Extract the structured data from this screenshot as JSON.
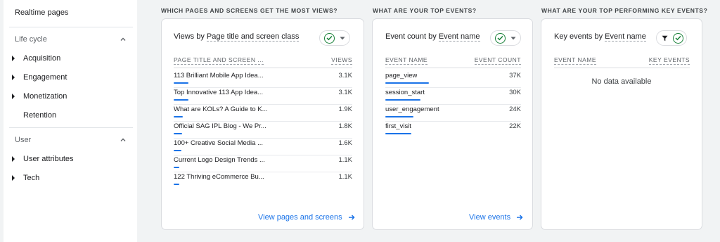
{
  "sidebar": {
    "realtime": "Realtime pages",
    "lifecycle": {
      "label": "Life cycle",
      "items": [
        "Acquisition",
        "Engagement",
        "Monetization",
        "Retention"
      ]
    },
    "user": {
      "label": "User",
      "items": [
        "User attributes",
        "Tech"
      ]
    }
  },
  "pages": {
    "section_title": "WHICH PAGES AND SCREENS GET THE MOST VIEWS?",
    "card_title_a": "Views by",
    "card_title_b": "Page title and screen class",
    "col_name": "PAGE TITLE AND SCREEN ...",
    "col_value": "VIEWS",
    "rows": [
      {
        "label": "113 Brilliant Mobile App Idea...",
        "value": "3.1K",
        "bar": 1.0
      },
      {
        "label": "Top Innovative 113 App Idea...",
        "value": "3.1K",
        "bar": 1.0
      },
      {
        "label": "What are KOLs? A Guide to K...",
        "value": "1.9K",
        "bar": 0.61
      },
      {
        "label": "Official SAG IPL Blog - We Pr...",
        "value": "1.8K",
        "bar": 0.58
      },
      {
        "label": "100+ Creative Social Media ...",
        "value": "1.6K",
        "bar": 0.52
      },
      {
        "label": "Current Logo Design Trends ...",
        "value": "1.1K",
        "bar": 0.36
      },
      {
        "label": "122 Thriving eCommerce Bu...",
        "value": "1.1K",
        "bar": 0.36
      }
    ],
    "link": "View pages and screens"
  },
  "events": {
    "section_title": "WHAT ARE YOUR TOP EVENTS?",
    "card_title_a": "Event count by",
    "card_title_b": "Event name",
    "col_name": "EVENT NAME",
    "col_value": "EVENT COUNT",
    "rows": [
      {
        "label": "page_view",
        "value": "37K",
        "bar": 1.0
      },
      {
        "label": "session_start",
        "value": "30K",
        "bar": 0.81
      },
      {
        "label": "user_engagement",
        "value": "24K",
        "bar": 0.65
      },
      {
        "label": "first_visit",
        "value": "22K",
        "bar": 0.59
      }
    ],
    "link": "View events"
  },
  "key_events": {
    "section_title": "WHAT ARE YOUR TOP PERFORMING KEY EVENTS?",
    "card_title_a": "Key events by",
    "card_title_b": "Event name",
    "col_name": "EVENT NAME",
    "col_value": "KEY EVENTS",
    "empty": "No data available"
  },
  "colors": {
    "accent": "#1a73e8",
    "check": "#188038"
  },
  "icons": {
    "caret": "caret-right-icon",
    "chevron": "chevron-up-icon",
    "check": "check-circle-icon",
    "filter": "filter-icon",
    "arrow": "arrow-right-icon"
  }
}
